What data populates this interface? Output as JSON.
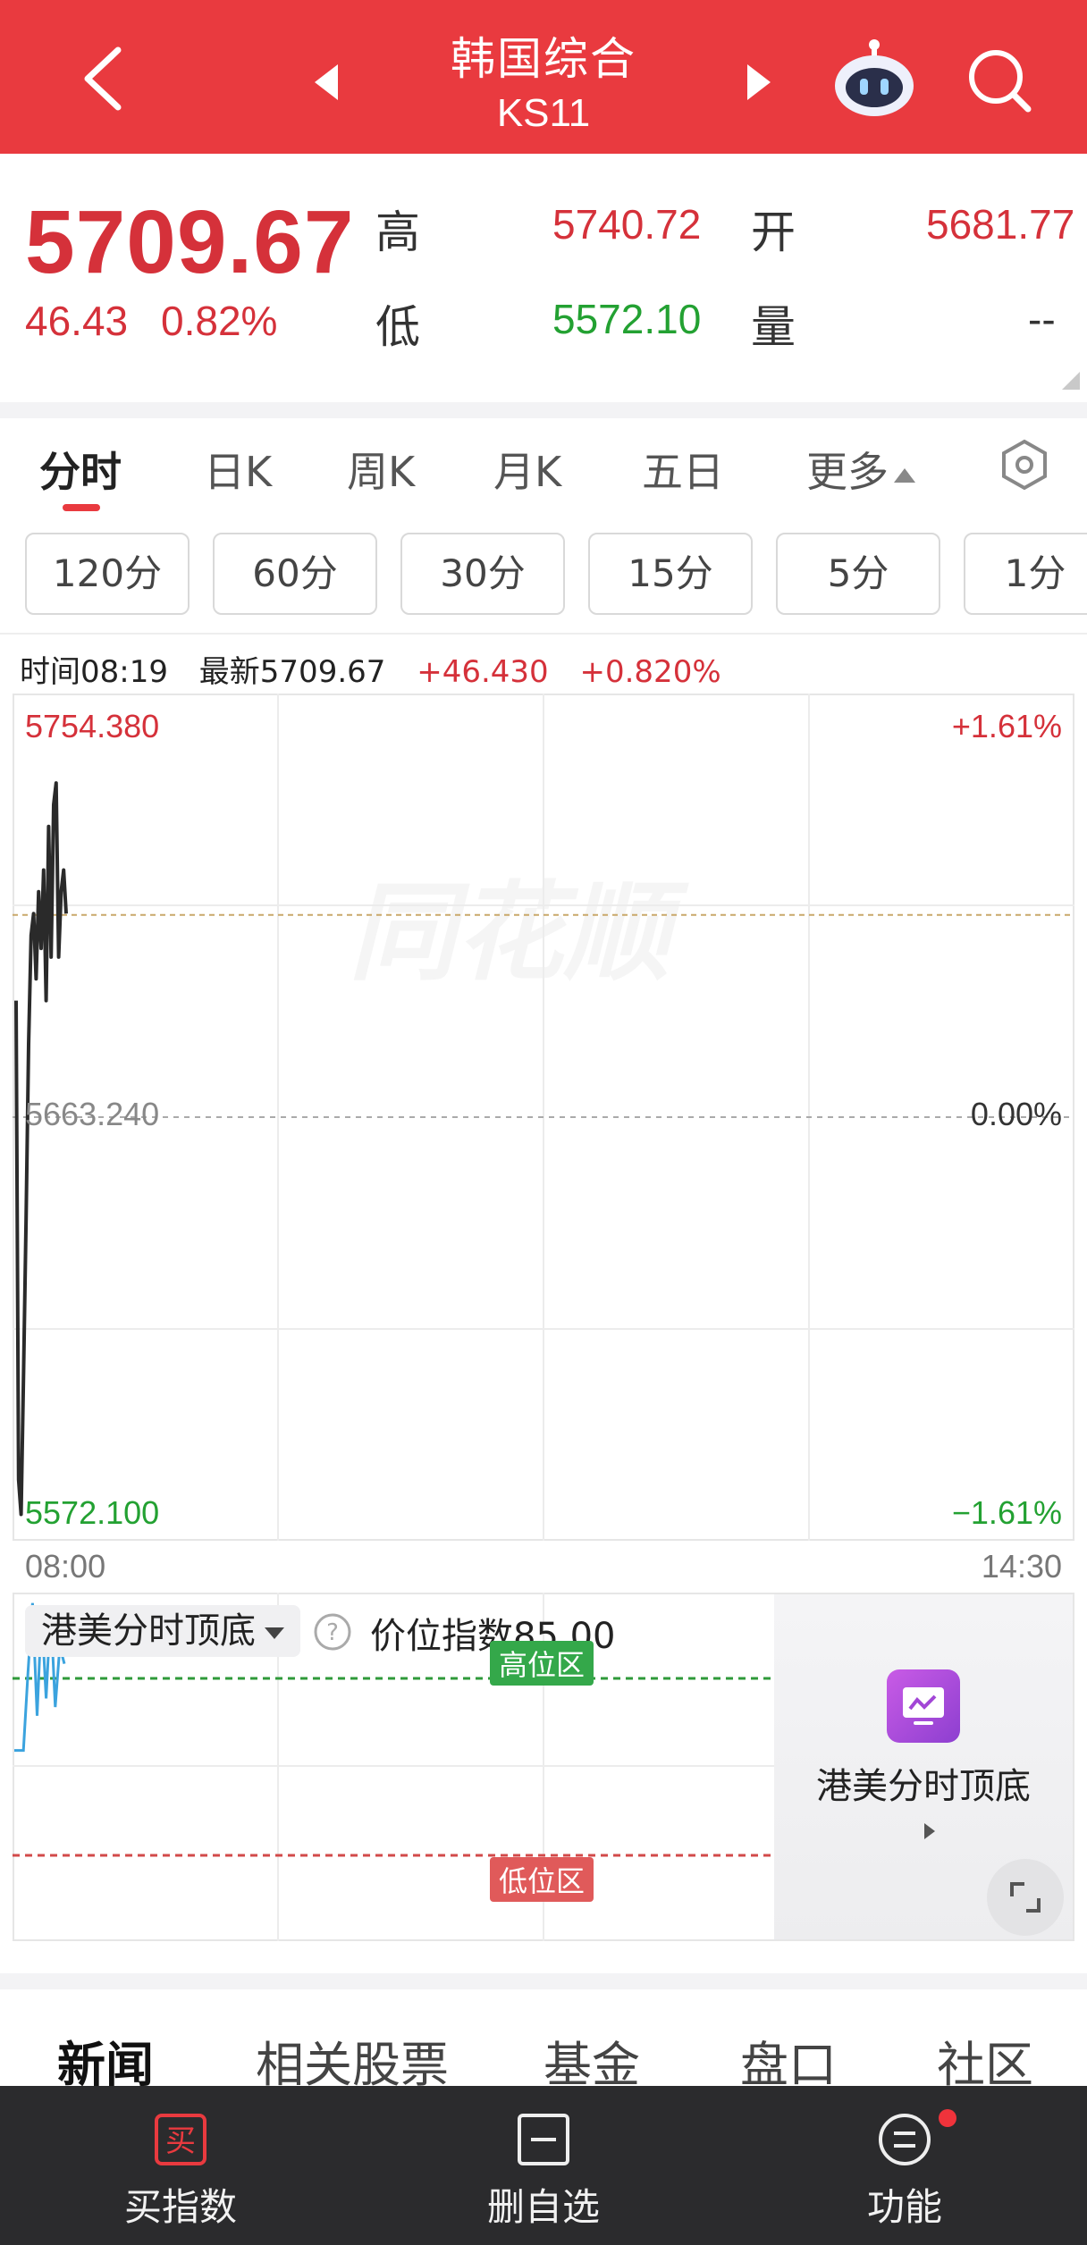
{
  "header": {
    "title": "韩国综合",
    "code": "KS11"
  },
  "quote": {
    "price": "5709.67",
    "change": "46.43",
    "change_pct": "0.82%",
    "high_label": "高",
    "high_value": "5740.72",
    "open_label": "开",
    "open_value": "5681.77",
    "low_label": "低",
    "low_value": "5572.10",
    "volume_label": "量",
    "volume_value": "--"
  },
  "period_tabs": [
    {
      "label": "分时",
      "active": true
    },
    {
      "label": "日K"
    },
    {
      "label": "周K"
    },
    {
      "label": "月K"
    },
    {
      "label": "五日"
    },
    {
      "label": "更多"
    }
  ],
  "minute_options": [
    "120分",
    "60分",
    "30分",
    "15分",
    "5分",
    "1分"
  ],
  "info_line": {
    "time": "时间08:19",
    "latest": "最新5709.67",
    "change": "+46.430",
    "change_pct": "+0.820%"
  },
  "chart_data": {
    "type": "line",
    "y_max_label": "5754.380",
    "y_mid_label": "5663.240",
    "y_min_label": "5572.100",
    "pct_max_label": "+1.61%",
    "pct_mid_label": "0.00%",
    "pct_min_label": "−1.61%",
    "x_start_label": "08:00",
    "x_end_label": "14:30",
    "watermark": "同花顺",
    "ylim": [
      5572.1,
      5754.38
    ],
    "reference_line": 5663.24,
    "latest_line": 5709.67,
    "colors": {
      "line": "#2a2a2a",
      "up": "#d5313a",
      "down": "#23a132"
    },
    "price_series": [
      5690,
      5580,
      5572,
      5605,
      5640,
      5680,
      5705,
      5710,
      5695,
      5715,
      5702,
      5720,
      5690,
      5730,
      5700,
      5735,
      5740,
      5700,
      5715,
      5720,
      5710
    ]
  },
  "indicator": {
    "name": "港美分时顶底",
    "value_text": "价位指数85.00",
    "high_zone": "高位区",
    "low_zone": "低位区",
    "card_title": "港美分时顶底",
    "series": [
      0.1,
      0.1,
      0.1,
      0.55,
      0.95,
      0.3,
      0.9,
      0.4,
      0.92,
      0.35,
      0.7,
      0.6
    ]
  },
  "news_tabs": [
    {
      "label": "新闻",
      "active": true
    },
    {
      "label": "相关股票"
    },
    {
      "label": "基金"
    },
    {
      "label": "盘口"
    },
    {
      "label": "社区"
    }
  ],
  "bottom_bar": {
    "buy_icon_text": "买",
    "buy_label": "买指数",
    "remove_label": "删自选",
    "function_label": "功能"
  }
}
